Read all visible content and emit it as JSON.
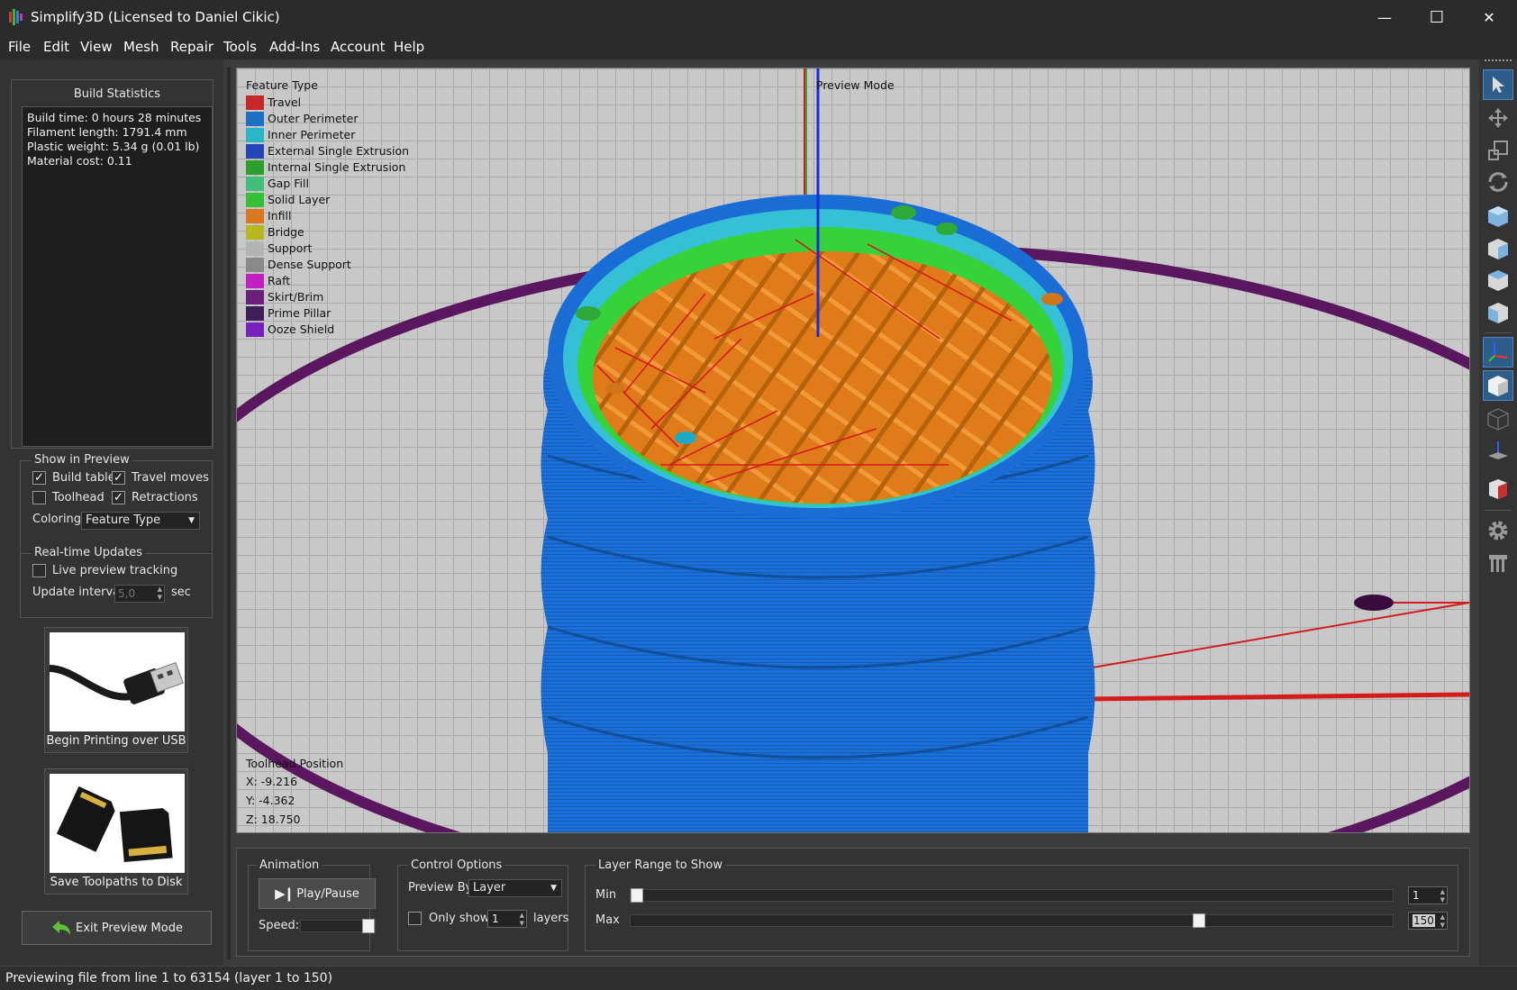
{
  "window": {
    "title": "Simplify3D (Licensed to Daniel Cikic)",
    "minimize": "—",
    "maximize": "☐",
    "close": "✕"
  },
  "menu": [
    "File",
    "Edit",
    "View",
    "Mesh",
    "Repair",
    "Tools",
    "Add-Ins",
    "Account",
    "Help"
  ],
  "build_statistics": {
    "title": "Build Statistics",
    "lines": [
      "Build time: 0 hours 28 minutes",
      "Filament length: 1791.4 mm",
      "Plastic weight: 5.34 g (0.01 lb)",
      "Material cost: 0.11"
    ]
  },
  "show_in_preview": {
    "title": "Show in Preview",
    "build_table": {
      "label": "Build table",
      "checked": true
    },
    "travel_moves": {
      "label": "Travel moves",
      "checked": true
    },
    "toolhead": {
      "label": "Toolhead",
      "checked": false
    },
    "retractions": {
      "label": "Retractions",
      "checked": true
    },
    "coloring_label": "Coloring",
    "coloring_value": "Feature Type"
  },
  "realtime_updates": {
    "title": "Real-time Updates",
    "live_tracking": {
      "label": "Live preview tracking",
      "checked": false
    },
    "interval_label": "Update interval",
    "interval_value": "5,0",
    "interval_unit": "sec"
  },
  "buttons": {
    "usb": "Begin Printing over USB",
    "save": "Save Toolpaths to Disk",
    "exit": "Exit Preview Mode"
  },
  "viewport": {
    "legend_title": "Feature Type",
    "mode_label": "Preview Mode",
    "legend": [
      {
        "name": "Travel",
        "color": "#c62828"
      },
      {
        "name": "Outer Perimeter",
        "color": "#1f6fc4"
      },
      {
        "name": "Inner Perimeter",
        "color": "#29b6c9"
      },
      {
        "name": "External Single Extrusion",
        "color": "#2346b8"
      },
      {
        "name": "Internal Single Extrusion",
        "color": "#2e9e2e"
      },
      {
        "name": "Gap Fill",
        "color": "#3fbf7a"
      },
      {
        "name": "Solid Layer",
        "color": "#36c036"
      },
      {
        "name": "Infill",
        "color": "#d9781e"
      },
      {
        "name": "Bridge",
        "color": "#b8b81e"
      },
      {
        "name": "Support",
        "color": "#b4b4b4"
      },
      {
        "name": "Dense Support",
        "color": "#8a8a8a"
      },
      {
        "name": "Raft",
        "color": "#c21fc2"
      },
      {
        "name": "Skirt/Brim",
        "color": "#6a1f7a"
      },
      {
        "name": "Prime Pillar",
        "color": "#3f1f5a"
      },
      {
        "name": "Ooze Shield",
        "color": "#7a1fbf"
      }
    ],
    "toolhead_title": "Toolhead Position",
    "x": "X: -9.216",
    "y": "Y: -4.362",
    "z": "Z: 18.750"
  },
  "animation": {
    "title": "Animation",
    "play": "Play/Pause",
    "speed": "Speed:"
  },
  "control_options": {
    "title": "Control Options",
    "preview_by_label": "Preview By",
    "preview_by_value": "Layer",
    "only_show": "Only show",
    "only_show_value": "1",
    "layers": "layers"
  },
  "layer_range": {
    "title": "Layer Range to Show",
    "min_label": "Min",
    "max_label": "Max",
    "min_value": "1",
    "max_value": "150",
    "min_fraction": 0.0,
    "max_fraction": 0.75
  },
  "status": "Previewing file from line 1 to 63154 (layer 1 to 150)"
}
